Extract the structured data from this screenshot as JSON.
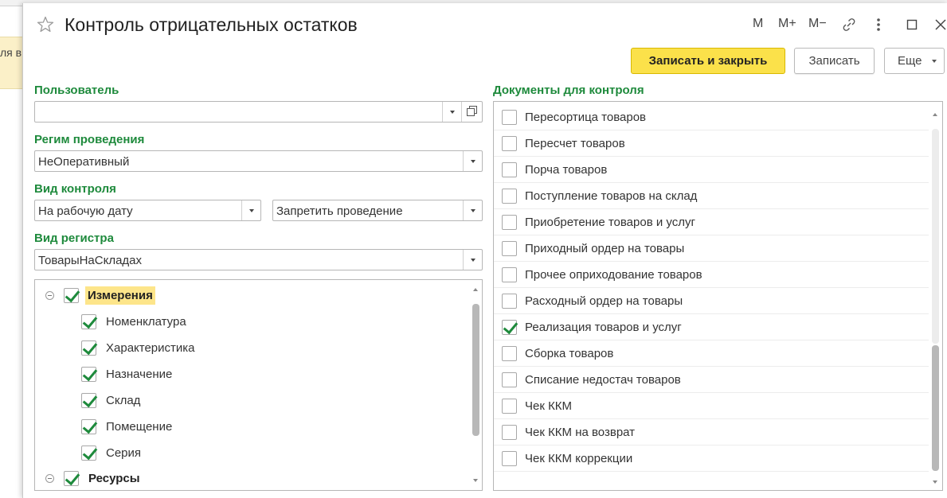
{
  "background": {
    "notice_text": "ля в"
  },
  "window": {
    "title": "Контроль отрицательных остатков",
    "tb_m": "M",
    "tb_mplus": "M+",
    "tb_mminus": "M−"
  },
  "commands": {
    "save_close": "Записать и закрыть",
    "save": "Записать",
    "more": "Еще"
  },
  "form": {
    "user_label": "Пользователь",
    "user_value": "",
    "mode_label": "Регим проведения",
    "mode_value": "НеОперативный",
    "control_label": "Вид контроля",
    "control_date_value": "На рабочую дату",
    "control_action_value": "Запретить проведение",
    "register_label": "Вид регистра",
    "register_value": "ТоварыНаСкладах"
  },
  "tree": {
    "groups": [
      {
        "label": "Измерения",
        "checked": true,
        "highlighted": true
      },
      {
        "label": "Ресурсы",
        "checked": true,
        "highlighted": false
      }
    ],
    "items": [
      {
        "label": "Номенклатура",
        "checked": true
      },
      {
        "label": "Характеристика",
        "checked": true
      },
      {
        "label": "Назначение",
        "checked": true
      },
      {
        "label": "Склад",
        "checked": true
      },
      {
        "label": "Помещение",
        "checked": true
      },
      {
        "label": "Серия",
        "checked": true
      }
    ]
  },
  "documents": {
    "label": "Документы для контроля",
    "items": [
      {
        "label": "Пересортица товаров",
        "checked": false
      },
      {
        "label": "Пересчет товаров",
        "checked": false
      },
      {
        "label": "Порча товаров",
        "checked": false
      },
      {
        "label": "Поступление товаров на склад",
        "checked": false
      },
      {
        "label": "Приобретение товаров и услуг",
        "checked": false
      },
      {
        "label": "Приходный ордер на товары",
        "checked": false
      },
      {
        "label": "Прочее оприходование товаров",
        "checked": false
      },
      {
        "label": "Расходный ордер на товары",
        "checked": false
      },
      {
        "label": "Реализация товаров и услуг",
        "checked": true
      },
      {
        "label": "Сборка товаров",
        "checked": false
      },
      {
        "label": "Списание недостач товаров",
        "checked": false
      },
      {
        "label": "Чек ККМ",
        "checked": false
      },
      {
        "label": "Чек ККМ на возврат",
        "checked": false
      },
      {
        "label": "Чек ККМ коррекции",
        "checked": false
      }
    ]
  },
  "colors": {
    "accent_green": "#1e8a3c",
    "primary_button": "#fbe14a",
    "highlight": "#fde58a"
  }
}
